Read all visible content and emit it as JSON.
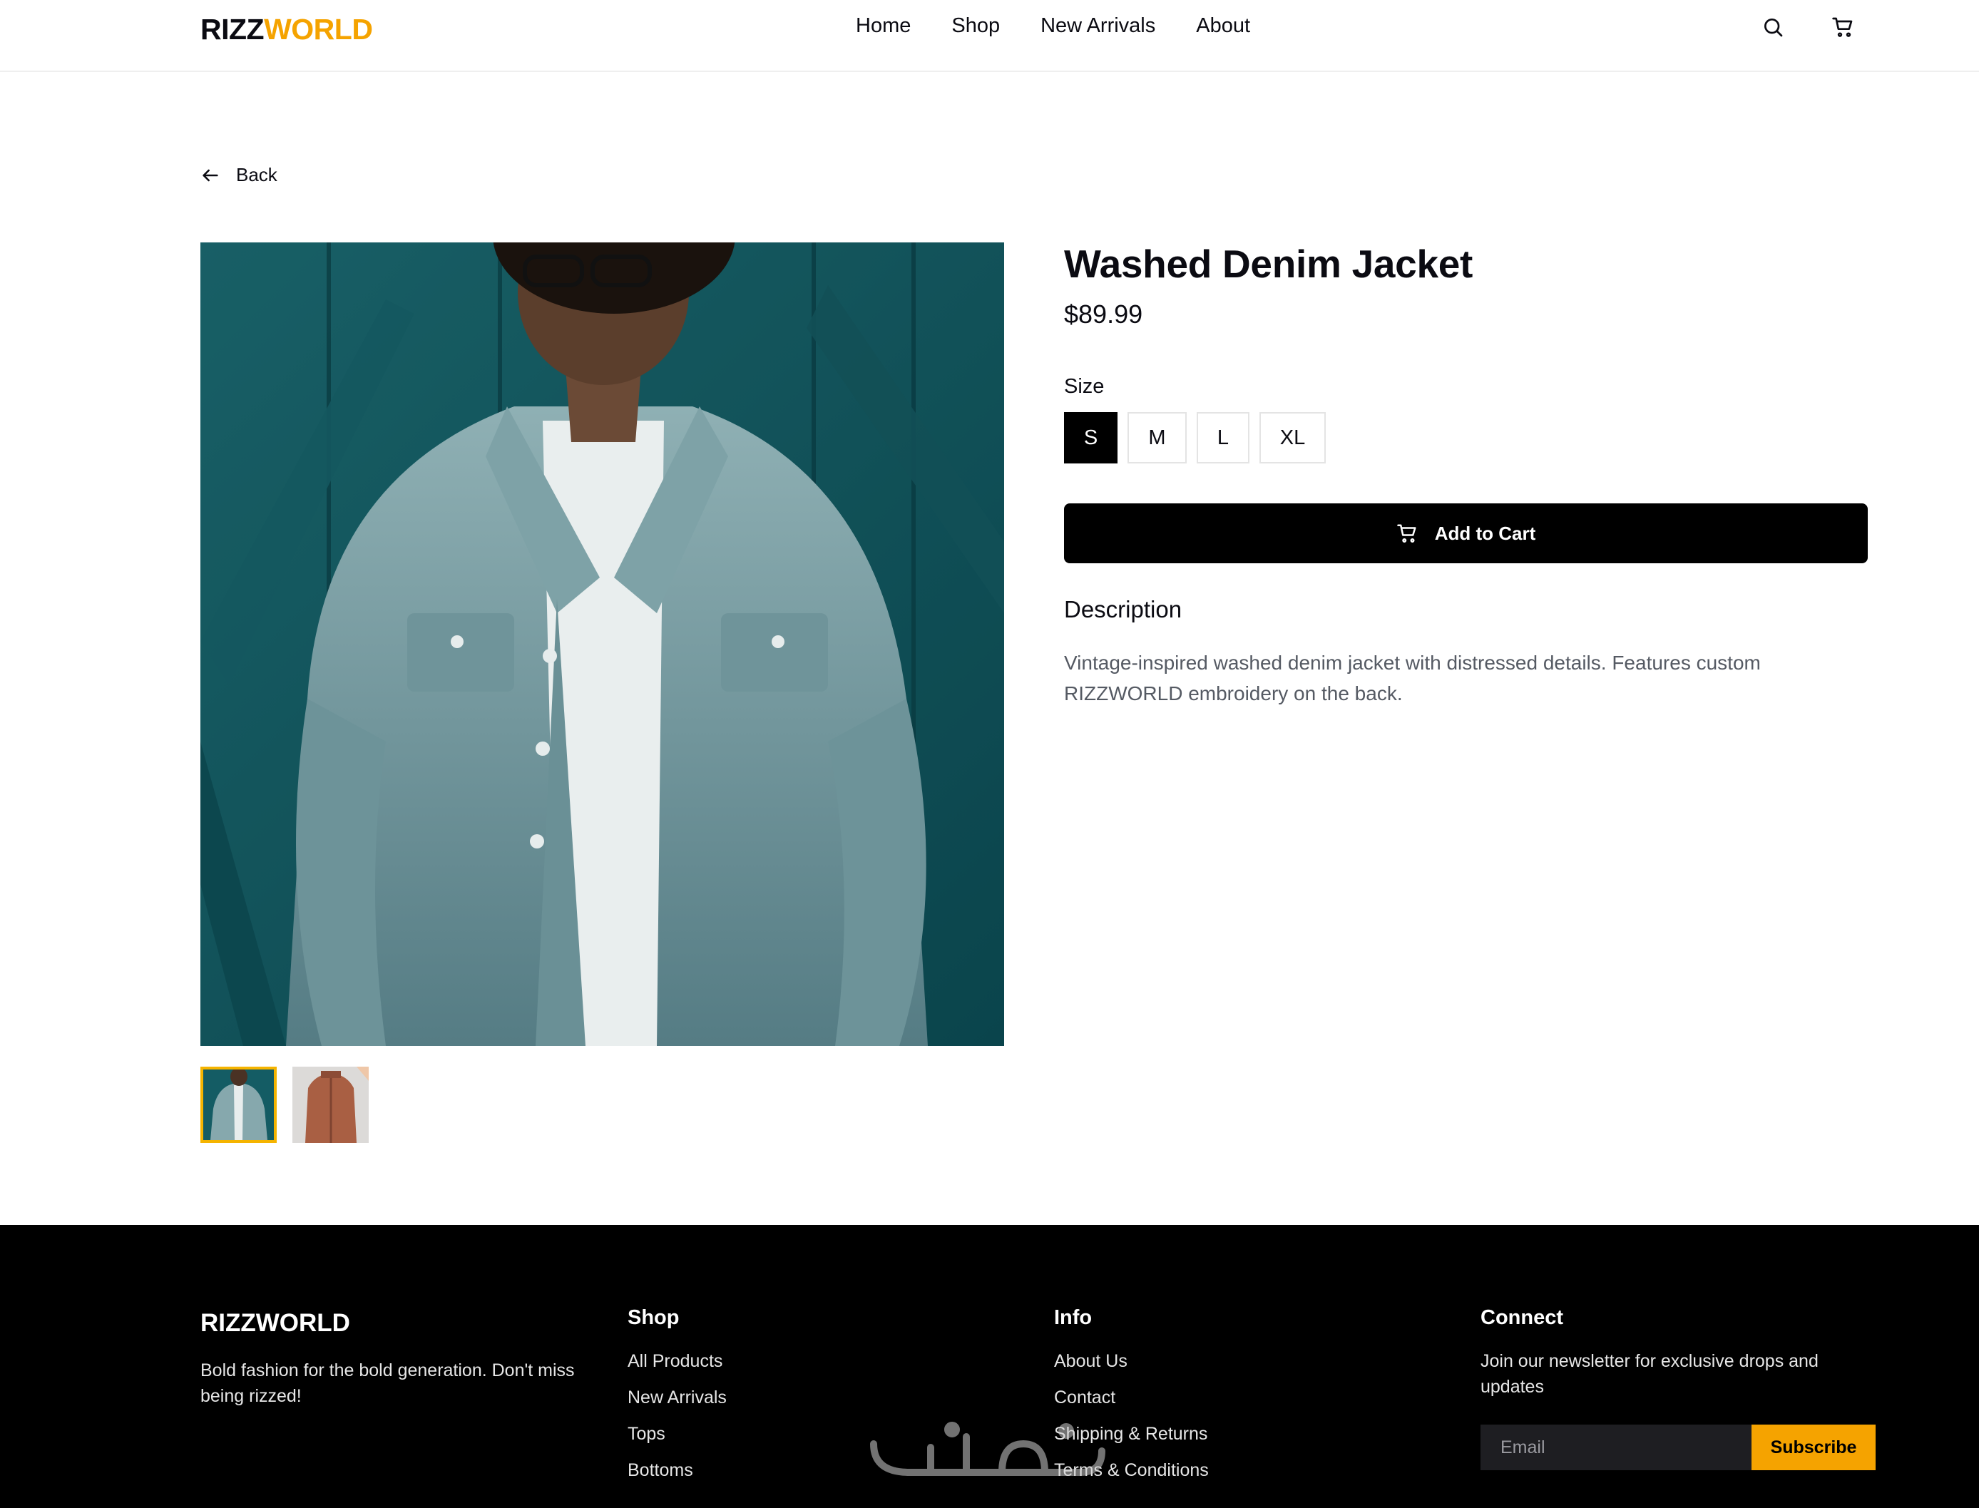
{
  "colors": {
    "accent": "#f5a300",
    "primary": "#000000",
    "text": "#0b0b12",
    "muted_text": "#555a63",
    "thumb_border": "#f5b400"
  },
  "header": {
    "logo_part1": "RIZZ",
    "logo_part2": "WORLD",
    "nav": [
      "Home",
      "Shop",
      "New Arrivals",
      "About"
    ],
    "icons": [
      "search-icon",
      "cart-icon"
    ]
  },
  "back_label": "Back",
  "product": {
    "title": "Washed Denim Jacket",
    "price": "$89.99",
    "size_label": "Size",
    "sizes": [
      "S",
      "M",
      "L",
      "XL"
    ],
    "selected_size": "S",
    "add_to_cart": "Add to Cart",
    "description_heading": "Description",
    "description": "Vintage-inspired washed denim jacket with distressed details. Features custom RIZZWORLD embroidery on the back."
  },
  "footer": {
    "brand": "RIZZWORLD",
    "tagline": "Bold fashion for the bold generation. Don't miss being rizzed!",
    "shop_heading": "Shop",
    "shop_links": [
      "All Products",
      "New Arrivals",
      "Tops",
      "Bottoms"
    ],
    "info_heading": "Info",
    "info_links": [
      "About Us",
      "Contact",
      "Shipping & Returns",
      "Terms & Conditions"
    ],
    "connect_heading": "Connect",
    "connect_text": "Join our newsletter for exclusive drops and updates",
    "email_placeholder": "Email",
    "subscribe_label": "Subscribe"
  }
}
